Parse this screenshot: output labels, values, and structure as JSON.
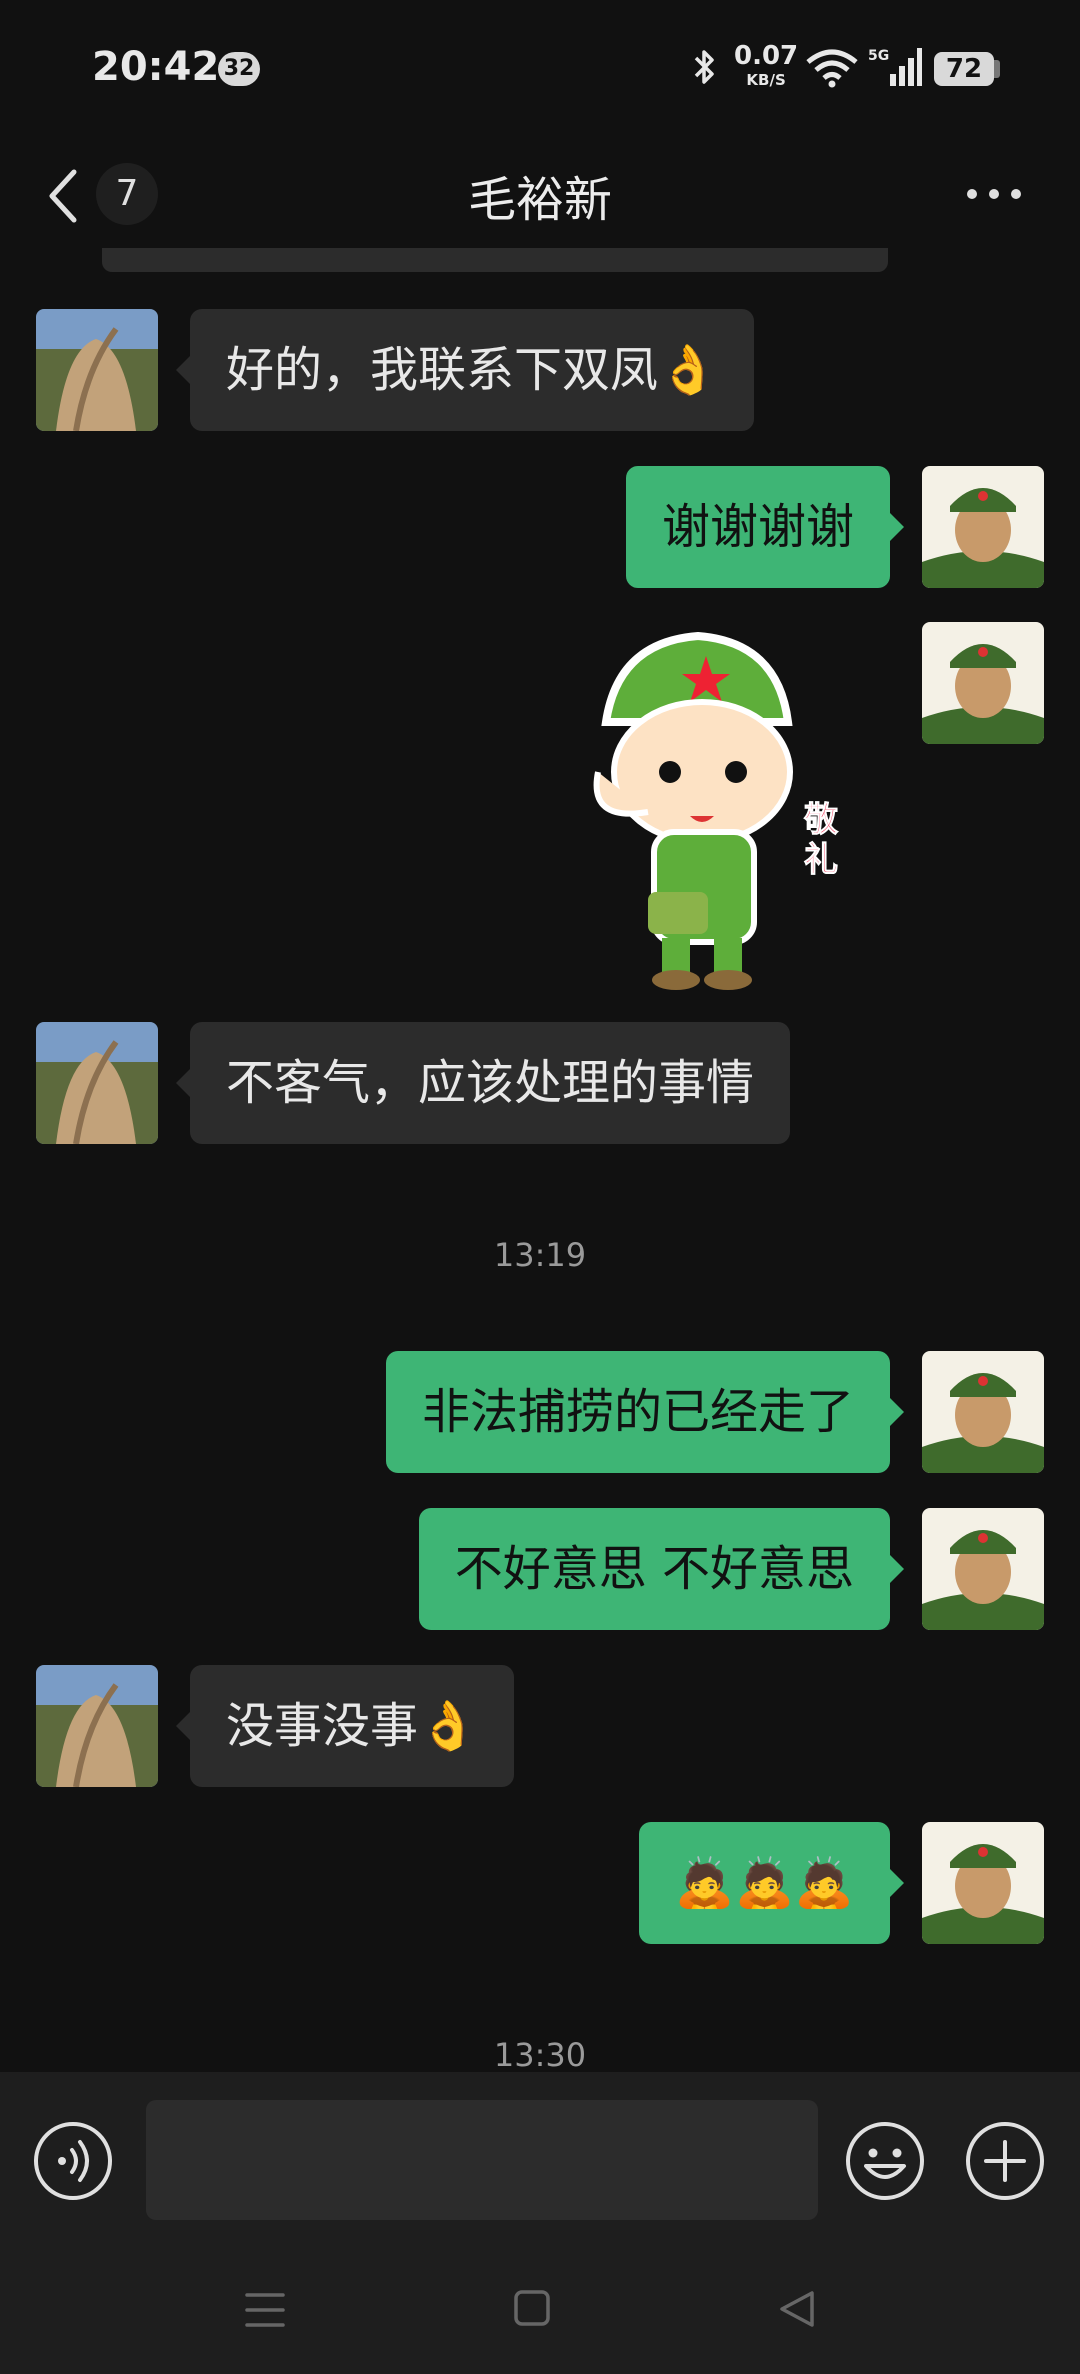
{
  "status_bar": {
    "time": "20:42",
    "notification_count": "32",
    "net_speed_value": "0.07",
    "net_speed_unit": "KB/S",
    "signal_label": "5G",
    "battery": "72"
  },
  "header": {
    "back_count": "7",
    "title": "毛裕新",
    "icons": [
      "back-chevron-icon",
      "more-icon"
    ]
  },
  "messages": [
    {
      "dir": "in",
      "text": "好的，我联系下双凤👌"
    },
    {
      "dir": "out",
      "text": "谢谢谢谢"
    },
    {
      "dir": "out",
      "sticker_text": "敬礼"
    },
    {
      "dir": "in",
      "text": "不客气，应该处理的事情"
    },
    {
      "timestamp": "13:19"
    },
    {
      "dir": "out",
      "text": "非法捕捞的已经走了"
    },
    {
      "dir": "out",
      "text": "不好意思 不好意思"
    },
    {
      "dir": "in",
      "text": "没事没事👌"
    },
    {
      "dir": "out",
      "text": "🙇🙇🙇"
    },
    {
      "timestamp": "13:30"
    }
  ],
  "input_bar": {
    "placeholder": "",
    "icons": [
      "voice-icon",
      "emoji-icon",
      "plus-icon"
    ]
  },
  "system_nav": {
    "icons": [
      "menu-icon",
      "home-icon",
      "back-triangle-icon"
    ]
  },
  "colors": {
    "background": "#111111",
    "incoming_bubble": "#2c2c2c",
    "outgoing_bubble": "#3eb575",
    "input_bar": "#1e1e1e"
  }
}
